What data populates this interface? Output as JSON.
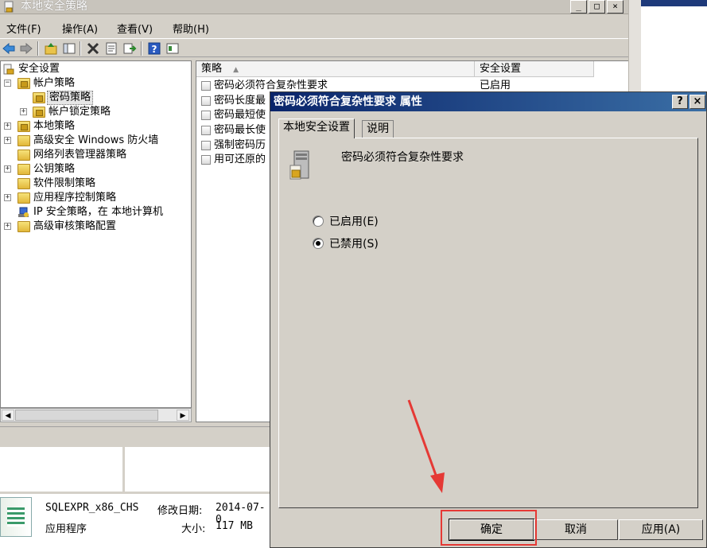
{
  "main_window": {
    "title": "本地安全策略",
    "window_buttons": {
      "minimize": "_",
      "restore": "□",
      "close": "×"
    }
  },
  "menubar": {
    "items": [
      "文件(F)",
      "操作(A)",
      "查看(V)",
      "帮助(H)"
    ]
  },
  "toolbar": {
    "icons": [
      "back-arrow-icon",
      "forward-arrow-icon",
      "up-folder-icon",
      "show-hide-tree-icon",
      "delete-icon",
      "properties-icon",
      "export-list-icon",
      "help-icon",
      "view-icon"
    ]
  },
  "tree": {
    "root": "安全设置",
    "items": [
      {
        "label": "帐户策略",
        "expander": "−"
      },
      {
        "label": "密码策略",
        "selected": true
      },
      {
        "label": "帐户锁定策略",
        "expander": "+"
      },
      {
        "label": "本地策略",
        "expander": "+"
      },
      {
        "label": "高级安全 Windows 防火墙",
        "expander": "+"
      },
      {
        "label": "网络列表管理器策略"
      },
      {
        "label": "公钥策略",
        "expander": "+"
      },
      {
        "label": "软件限制策略"
      },
      {
        "label": "应用程序控制策略",
        "expander": "+"
      },
      {
        "label": "IP 安全策略，在 本地计算机"
      },
      {
        "label": "高级审核策略配置",
        "expander": "+"
      }
    ]
  },
  "list": {
    "columns": [
      "策略",
      "安全设置"
    ],
    "rows": [
      {
        "policy": "密码必须符合复杂性要求",
        "setting": "已启用"
      },
      {
        "policy": "密码长度最",
        "setting": ""
      },
      {
        "policy": "密码最短使",
        "setting": ""
      },
      {
        "policy": "密码最长使",
        "setting": ""
      },
      {
        "policy": "强制密码历",
        "setting": ""
      },
      {
        "policy": "用可还原的",
        "setting": ""
      }
    ]
  },
  "file_info": {
    "name": "SQLEXPR_x86_CHS",
    "modified_label": "修改日期:",
    "modified_value": "2014-07-0",
    "type": "应用程序",
    "size_label": "大小:",
    "size_value": "117 MB"
  },
  "dialog": {
    "title": "密码必须符合复杂性要求 属性",
    "help_button": "?",
    "close_button": "×",
    "tabs": [
      "本地安全设置",
      "说明"
    ],
    "active_tab": 0,
    "policy_name": "密码必须符合复杂性要求",
    "options": [
      {
        "label": "已启用(E)",
        "checked": false
      },
      {
        "label": "已禁用(S)",
        "checked": true
      }
    ],
    "buttons": {
      "ok": "确定",
      "cancel": "取消",
      "apply": "应用(A)"
    }
  },
  "annotation": {
    "color": "#e53935"
  }
}
